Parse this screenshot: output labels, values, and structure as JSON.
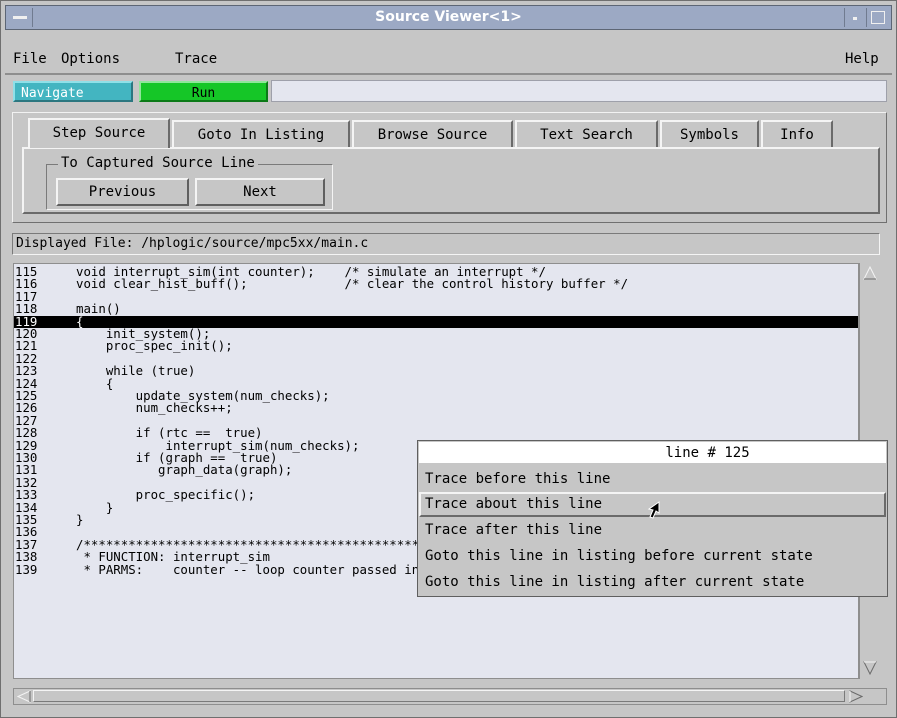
{
  "window": {
    "title": "Source Viewer<1>"
  },
  "menubar": {
    "file": "File",
    "options": "Options",
    "trace": "Trace",
    "help": "Help"
  },
  "toolbar": {
    "navigate": "Navigate",
    "run": "Run",
    "navigate_color": "#43b5c1",
    "run_color": "#15c627"
  },
  "tabs": [
    {
      "label": "Step Source",
      "active": true
    },
    {
      "label": "Goto In Listing"
    },
    {
      "label": "Browse Source"
    },
    {
      "label": "Text Search"
    },
    {
      "label": "Symbols"
    },
    {
      "label": "Info"
    }
  ],
  "step_source": {
    "group_label": "To Captured Source Line",
    "previous": "Previous",
    "next": "Next"
  },
  "displayed_file": "Displayed File: /hplogic/source/mpc5xx/main.c",
  "source_lines": [
    {
      "num": "115",
      "text": "void interrupt_sim(int counter);    /* simulate an interrupt */"
    },
    {
      "num": "116",
      "text": "void clear_hist_buff();             /* clear the control history buffer */"
    },
    {
      "num": "117",
      "text": ""
    },
    {
      "num": "118",
      "text": "main()"
    },
    {
      "num": "119",
      "text": "{",
      "selected": true
    },
    {
      "num": "120",
      "text": "    init_system();"
    },
    {
      "num": "121",
      "text": "    proc_spec_init();"
    },
    {
      "num": "122",
      "text": ""
    },
    {
      "num": "123",
      "text": "    while (true)"
    },
    {
      "num": "124",
      "text": "    {"
    },
    {
      "num": "125",
      "text": "        update_system(num_checks);"
    },
    {
      "num": "126",
      "text": "        num_checks++;"
    },
    {
      "num": "127",
      "text": ""
    },
    {
      "num": "128",
      "text": "        if (rtc ==  true)"
    },
    {
      "num": "129",
      "text": "            interrupt_sim(num_checks);"
    },
    {
      "num": "130",
      "text": "        if (graph ==  true)"
    },
    {
      "num": "131",
      "text": "           graph_data(graph);"
    },
    {
      "num": "132",
      "text": ""
    },
    {
      "num": "133",
      "text": "        proc_specific();"
    },
    {
      "num": "134",
      "text": "    }"
    },
    {
      "num": "135",
      "text": "}"
    },
    {
      "num": "136",
      "text": ""
    },
    {
      "num": "137",
      "text": "/*************************************************************************"
    },
    {
      "num": "138",
      "text": " * FUNCTION: interrupt_sim"
    },
    {
      "num": "139",
      "text": " * PARMS:    counter -- loop counter passed in from main"
    }
  ],
  "popup": {
    "title": "line # 125",
    "items": [
      "Trace before this line",
      "Trace about this line",
      "Trace after this line",
      "Goto this line in listing before current state",
      "Goto this line in listing after current state"
    ],
    "highlighted_index": 1
  }
}
